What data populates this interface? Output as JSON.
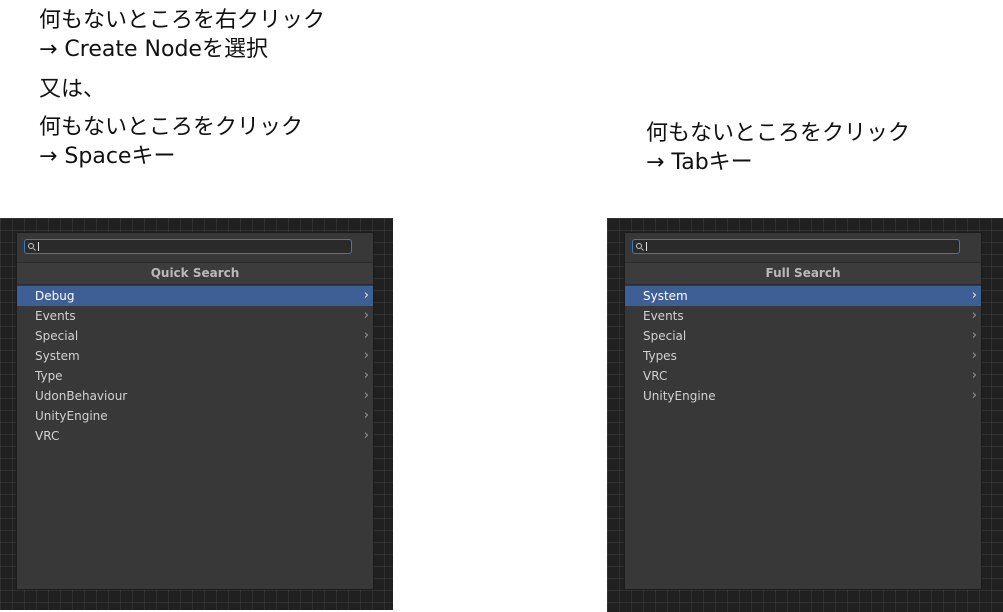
{
  "notes": {
    "left_a": [
      "何もないところを右クリック",
      "→ Create Nodeを選択"
    ],
    "left_or": "又は、",
    "left_b": [
      "何もないところをクリック",
      "→ Spaceキー"
    ],
    "right": [
      "何もないところをクリック",
      "→ Tabキー"
    ]
  },
  "quick_search": {
    "title": "Quick Search",
    "search_value": "",
    "selected_index": 0,
    "items": [
      "Debug",
      "Events",
      "Special",
      "System",
      "Type",
      "UdonBehaviour",
      "UnityEngine",
      "VRC"
    ]
  },
  "full_search": {
    "title": "Full Search",
    "search_value": "",
    "selected_index": 0,
    "items": [
      "System",
      "Events",
      "Special",
      "Types",
      "VRC",
      "UnityEngine"
    ]
  },
  "icons": {
    "search": "search-icon",
    "submenu": "chevron-right-icon"
  },
  "colors": {
    "selection": "#3e5f96",
    "focus_border": "#3a79bb",
    "panel": "#383838",
    "graph_background": "#202020"
  }
}
